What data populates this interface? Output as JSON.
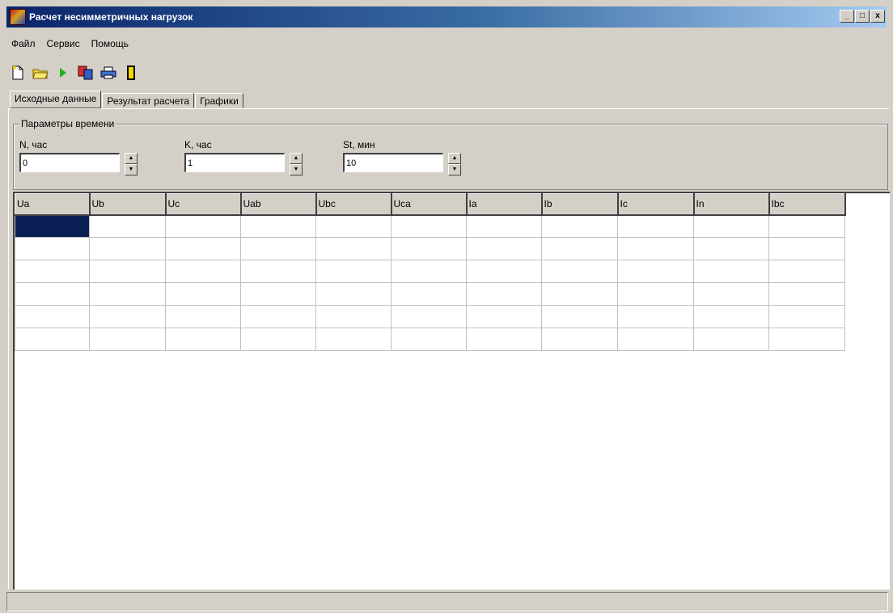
{
  "window": {
    "title": "Расчет несимметричных нагрузок",
    "buttons": [
      "_",
      "□",
      "x"
    ]
  },
  "menu": [
    "Файл",
    "Сервис",
    "Помощь"
  ],
  "toolbar": [
    "new-file-icon",
    "open-folder-icon",
    "run-icon",
    "copy-icon",
    "print-icon",
    "exit-icon"
  ],
  "tabs": [
    {
      "label": "Исходные данные",
      "active": true
    },
    {
      "label": "Результат расчета",
      "active": false
    },
    {
      "label": "Графики",
      "active": false
    }
  ],
  "time_params": {
    "legend": "Параметры времени",
    "fields": [
      {
        "label": "N, час",
        "value": "0"
      },
      {
        "label": "K, час",
        "value": "1"
      },
      {
        "label": "St, мин",
        "value": "10"
      }
    ]
  },
  "table": {
    "columns": [
      "Ua",
      "Ub",
      "Uc",
      "Uab",
      "Ubc",
      "Uca",
      "Ia",
      "Ib",
      "Ic",
      "In",
      "Ibc"
    ],
    "row_count": 6
  },
  "colors": {
    "title_start": "#0a246a",
    "selected_cell": "#0a1f54",
    "face": "#d4d0c8"
  }
}
